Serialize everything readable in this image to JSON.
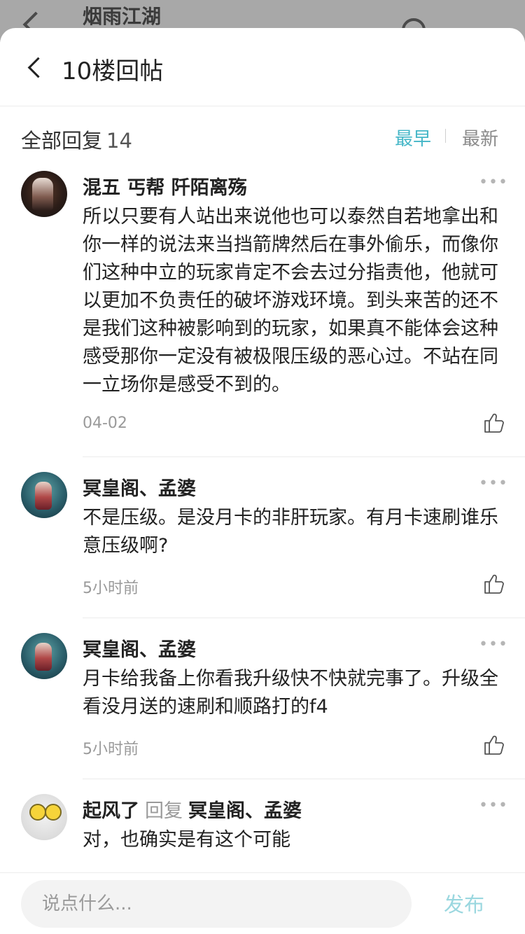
{
  "background": {
    "title": "烟雨江湖"
  },
  "sheet": {
    "title": "10楼回帖",
    "all_replies_label": "全部回复",
    "reply_count": "14",
    "sort_earliest": "最早",
    "sort_latest": "最新"
  },
  "replies": [
    {
      "author": "混五 丐帮 阡陌离殇",
      "content": "所以只要有人站出来说他也可以泰然自若地拿出和你一样的说法来当挡箭牌然后在事外偷乐，而像你们这种中立的玩家肯定不会去过分指责他，他就可以更加不负责任的破坏游戏环境。到头来苦的还不是我们这种被影响到的玩家，如果真不能体会这种感受那你一定没有被极限压级的恶心过。不站在同一立场你是感受不到的。",
      "time": "04-02"
    },
    {
      "author": "冥皇阁、孟婆",
      "content": "不是压级。是没月卡的非肝玩家。有月卡速刷谁乐意压级啊?",
      "time": "5小时前"
    },
    {
      "author": "冥皇阁、孟婆",
      "content": "月卡给我备上你看我升级快不快就完事了。升级全看没月送的速刷和顺路打的f4",
      "time": "5小时前"
    },
    {
      "author": "起风了",
      "reply_word": "回复",
      "reply_target": "冥皇阁、孟婆",
      "content": "对，也确实是有这个可能"
    }
  ],
  "input": {
    "placeholder": "说点什么...",
    "publish_label": "发布"
  },
  "colors": {
    "accent": "#44b6c7",
    "publish_disabled": "#9ad7df",
    "muted": "#9a9a9a"
  }
}
